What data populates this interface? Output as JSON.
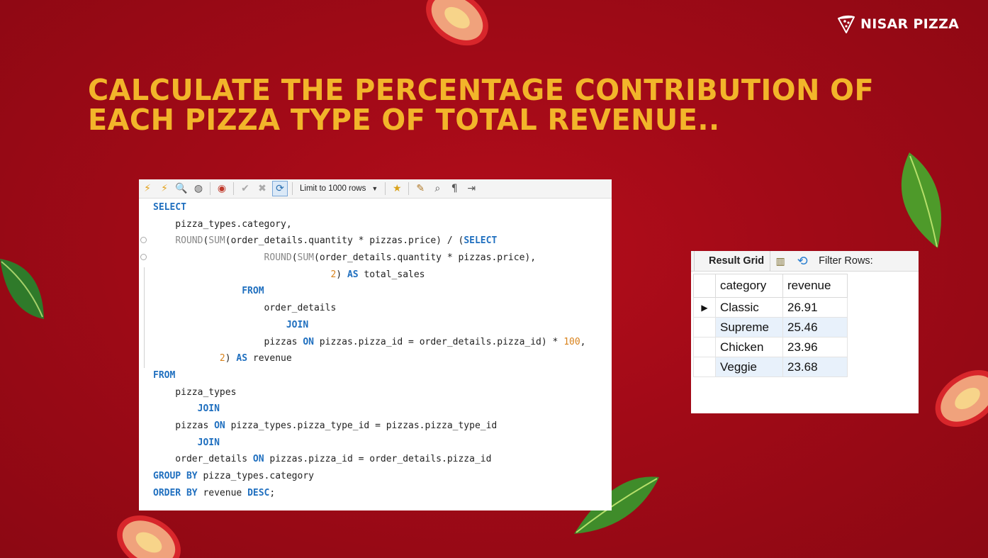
{
  "brand": {
    "name": "NISAR PIZZA",
    "icon": "pizza-slice-icon"
  },
  "title": {
    "line1": "CALCULATE THE PERCENTAGE CONTRIBUTION OF",
    "line2": "EACH PIZZA TYPE OF TOTAL REVENUE.."
  },
  "colors": {
    "background": "#a10a17",
    "title": "#f2b52a",
    "keyword": "#1f6fbf",
    "number": "#d8821b"
  },
  "editor": {
    "toolbar": {
      "limit_label": "Limit to 1000 rows",
      "icons": [
        "execute-icon",
        "execute-current-icon",
        "explain-icon",
        "stop-icon",
        "toggle-error-icon",
        "commit-icon",
        "rollback-icon",
        "autocommit-icon",
        "limit-dropdown",
        "bookmark-icon",
        "beautify-icon",
        "find-icon",
        "invisible-chars-icon",
        "wrap-icon"
      ]
    },
    "lines": [
      [
        {
          "t": "SELECT",
          "c": "kw"
        }
      ],
      [
        {
          "t": "    pizza_types.category,"
        }
      ],
      [
        {
          "t": "    "
        },
        {
          "t": "ROUND",
          "c": "fn"
        },
        {
          "t": "("
        },
        {
          "t": "SUM",
          "c": "fn"
        },
        {
          "t": "(order_details.quantity * pizzas.price) / ("
        },
        {
          "t": "SELECT",
          "c": "kw"
        }
      ],
      [
        {
          "t": "                    "
        },
        {
          "t": "ROUND",
          "c": "fn"
        },
        {
          "t": "("
        },
        {
          "t": "SUM",
          "c": "fn"
        },
        {
          "t": "(order_details.quantity * pizzas.price),"
        }
      ],
      [
        {
          "t": "                                "
        },
        {
          "t": "2",
          "c": "num"
        },
        {
          "t": ") "
        },
        {
          "t": "AS",
          "c": "kw"
        },
        {
          "t": " total_sales"
        }
      ],
      [
        {
          "t": "                "
        },
        {
          "t": "FROM",
          "c": "kw"
        }
      ],
      [
        {
          "t": "                    order_details"
        }
      ],
      [
        {
          "t": "                        "
        },
        {
          "t": "JOIN",
          "c": "kw"
        }
      ],
      [
        {
          "t": "                    pizzas "
        },
        {
          "t": "ON",
          "c": "kw"
        },
        {
          "t": " pizzas.pizza_id = order_details.pizza_id) * "
        },
        {
          "t": "100",
          "c": "num"
        },
        {
          "t": ","
        }
      ],
      [
        {
          "t": "            "
        },
        {
          "t": "2",
          "c": "num"
        },
        {
          "t": ") "
        },
        {
          "t": "AS",
          "c": "kw"
        },
        {
          "t": " revenue"
        }
      ],
      [
        {
          "t": "FROM",
          "c": "kw"
        }
      ],
      [
        {
          "t": "    pizza_types"
        }
      ],
      [
        {
          "t": "        "
        },
        {
          "t": "JOIN",
          "c": "kw"
        }
      ],
      [
        {
          "t": "    pizzas "
        },
        {
          "t": "ON",
          "c": "kw"
        },
        {
          "t": " pizza_types.pizza_type_id = pizzas.pizza_type_id"
        }
      ],
      [
        {
          "t": "        "
        },
        {
          "t": "JOIN",
          "c": "kw"
        }
      ],
      [
        {
          "t": "    order_details "
        },
        {
          "t": "ON",
          "c": "kw"
        },
        {
          "t": " pizzas.pizza_id = order_details.pizza_id"
        }
      ],
      [
        {
          "t": "GROUP BY",
          "c": "kw"
        },
        {
          "t": " pizza_types.category"
        }
      ],
      [
        {
          "t": "ORDER BY",
          "c": "kw"
        },
        {
          "t": " revenue "
        },
        {
          "t": "DESC",
          "c": "kw"
        },
        {
          "t": ";"
        }
      ]
    ]
  },
  "result": {
    "tab_label": "Result Grid",
    "filter_label": "Filter Rows:",
    "columns": [
      "category",
      "revenue"
    ],
    "rows": [
      {
        "category": "Classic",
        "revenue": "26.91",
        "current": true
      },
      {
        "category": "Supreme",
        "revenue": "25.46"
      },
      {
        "category": "Chicken",
        "revenue": "23.96"
      },
      {
        "category": "Veggie",
        "revenue": "23.68"
      }
    ]
  }
}
